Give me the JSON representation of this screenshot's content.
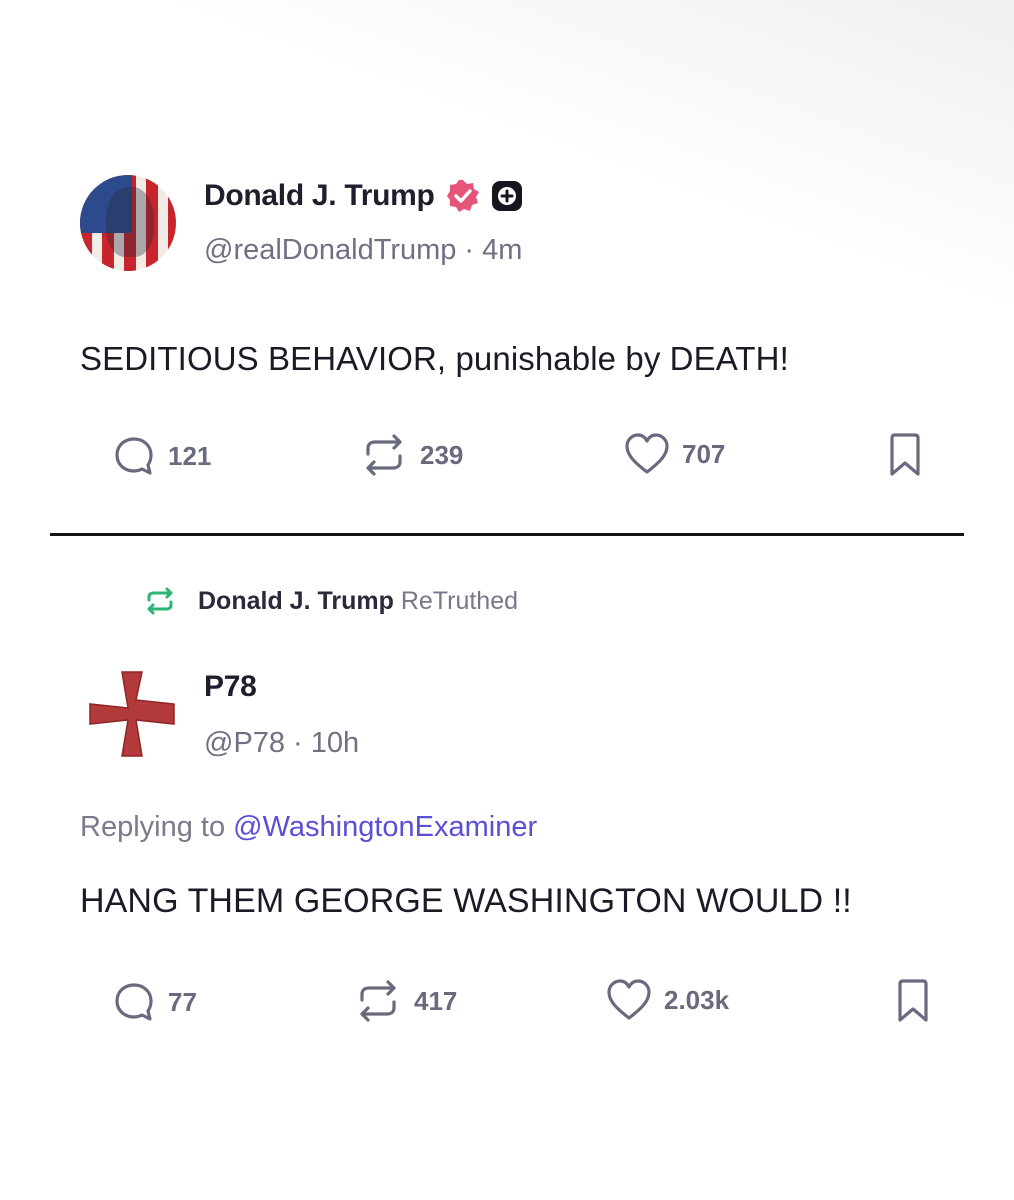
{
  "post1": {
    "display_name": "Donald J. Trump",
    "handle": "@realDonaldTrump",
    "separator": "·",
    "time": "4m",
    "text": "SEDITIOUS BEHAVIOR, punishable by DEATH!",
    "replies": "121",
    "retruths": "239",
    "likes": "707",
    "icons": [
      "verified-icon",
      "plus-icon",
      "reply-icon",
      "retruth-icon",
      "heart-icon",
      "bookmark-icon"
    ]
  },
  "post2": {
    "retruth_by": "Donald J. Trump",
    "retruth_label": "ReTruthed",
    "display_name": "P78",
    "handle": "@P78",
    "separator": "·",
    "time": "10h",
    "replying_prefix": "Replying to",
    "replying_handle": "@WashingtonExaminer",
    "text": "HANG THEM GEORGE WASHINGTON WOULD !!",
    "replies": "77",
    "retruths": "417",
    "likes": "2.03k"
  },
  "colors": {
    "verified_badge": "#e5557a",
    "retruth_green": "#2bb673",
    "link": "#5b4fd6",
    "avatar_cross": "#b23a3a",
    "action_grey": "#6a6a7e"
  }
}
